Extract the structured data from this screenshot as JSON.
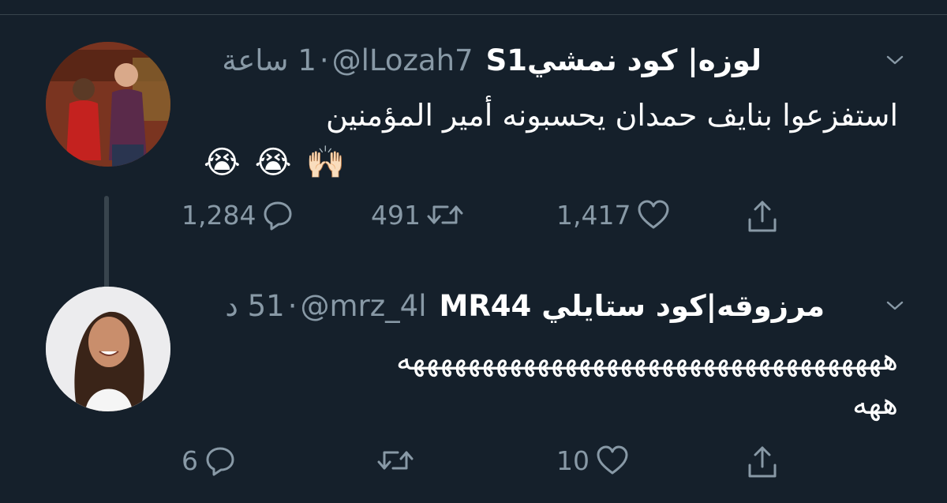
{
  "tweets": [
    {
      "display_name": "لوزه| كود نمشيS1",
      "handle": "@lLozah7",
      "time": "1 ساعة",
      "text": "استفزعوا بنايف حمدان يحسبونه أمير المؤمنين",
      "emojis": [
        "😭",
        "😭",
        "🙌🏻"
      ],
      "counts": {
        "replies": "1,284",
        "retweets": "491",
        "likes": "1,417"
      }
    },
    {
      "display_name": "مرزوقه|كود ستايلي MR44",
      "handle": "@mrz_4l",
      "time": "51 د",
      "text_line1": "هههههههههههههههههههههههههههههههههههه",
      "text_line2": "ههه",
      "counts": {
        "replies": "6",
        "retweets": "",
        "likes": "10"
      }
    }
  ],
  "colors": {
    "background": "#15202b",
    "secondary_text": "#8899a6",
    "divider": "#38444d"
  },
  "icons": [
    "chevron-down-icon",
    "reply-icon",
    "retweet-icon",
    "like-icon",
    "share-icon"
  ]
}
